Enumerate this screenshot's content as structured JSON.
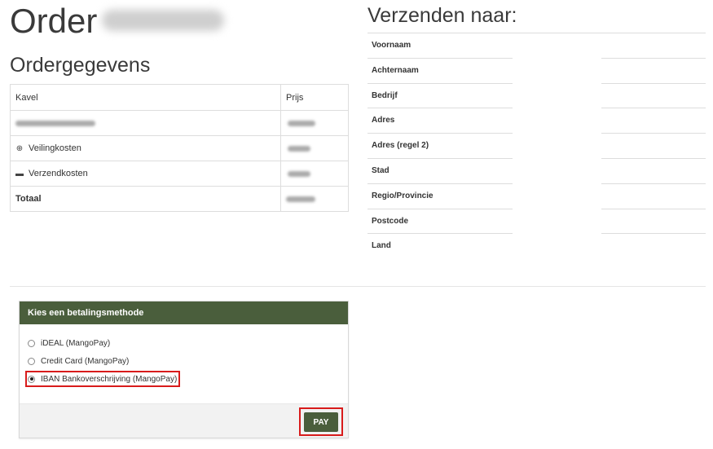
{
  "order": {
    "title_prefix": "Order"
  },
  "order_details": {
    "title": "Ordergegevens",
    "header": {
      "col1": "Kavel",
      "col2": "Prijs"
    },
    "rows": [
      {
        "label": "",
        "icon": ""
      },
      {
        "label": "Veilingkosten",
        "icon": "plus-circle-icon"
      },
      {
        "label": "Verzendkosten",
        "icon": "truck-icon"
      }
    ],
    "total_label": "Totaal"
  },
  "shipping": {
    "title": "Verzenden naar:",
    "fields": [
      "Voornaam",
      "Achternaam",
      "Bedrijf",
      "Adres",
      "Adres (regel 2)",
      "Stad",
      "Regio/Provincie",
      "Postcode",
      "Land"
    ]
  },
  "payment": {
    "header": "Kies een betalingsmethode",
    "options": [
      "iDEAL (MangoPay)",
      "Credit Card (MangoPay)",
      "IBAN Bankoverschrijving (MangoPay)"
    ],
    "selected_index": 2,
    "pay_label": "PAY",
    "accent_color": "#4a5e3c",
    "highlight_color": "#d81b1b"
  }
}
